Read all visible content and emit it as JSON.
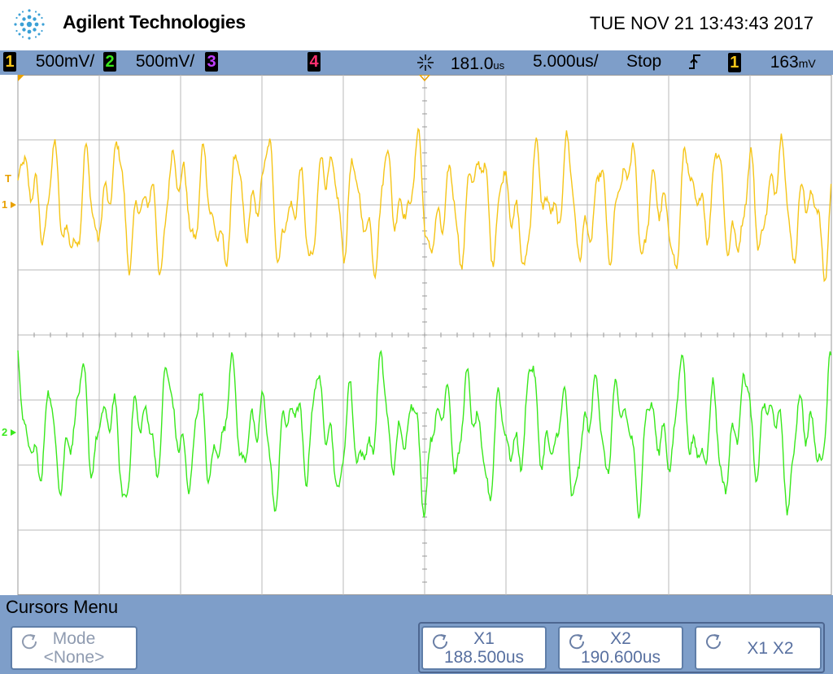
{
  "header": {
    "brand": "Agilent Technologies",
    "datetime": "TUE NOV 21 13:43:43 2017"
  },
  "status": {
    "ch1": {
      "num": "1",
      "scale": "500",
      "unit": "mV/",
      "color": "#f5c518"
    },
    "ch2": {
      "num": "2",
      "scale": "500",
      "unit": "mV/",
      "color": "#39e81c"
    },
    "ch3": {
      "num": "3",
      "color": "#c040ff"
    },
    "ch4": {
      "num": "4",
      "color": "#ff3070"
    },
    "delay": "181.0",
    "delay_unit": "us",
    "timebase": "5.000",
    "timebase_unit": "us/",
    "run_state": "Stop",
    "trig_source": "1",
    "trig_level": "163",
    "trig_unit": "mV"
  },
  "markers": {
    "trigger": "T",
    "ch1": "1",
    "ch2": "2"
  },
  "menu": {
    "title": "Cursors Menu",
    "mode_label": "Mode",
    "mode_value": "<None>",
    "x1_label": "X1",
    "x1_value": "188.500us",
    "x2_label": "X2",
    "x2_value": "190.600us",
    "x1x2_label": "X1 X2"
  },
  "chart_data": {
    "type": "line",
    "grid": true,
    "divisions_x": 10,
    "divisions_y": 8,
    "series": [
      {
        "name": "1",
        "color": "#f5c518",
        "volts_per_div": 0.5,
        "offset_div": 2.0
      },
      {
        "name": "2",
        "color": "#39e81c",
        "volts_per_div": 0.5,
        "offset_div": -1.5
      }
    ]
  }
}
